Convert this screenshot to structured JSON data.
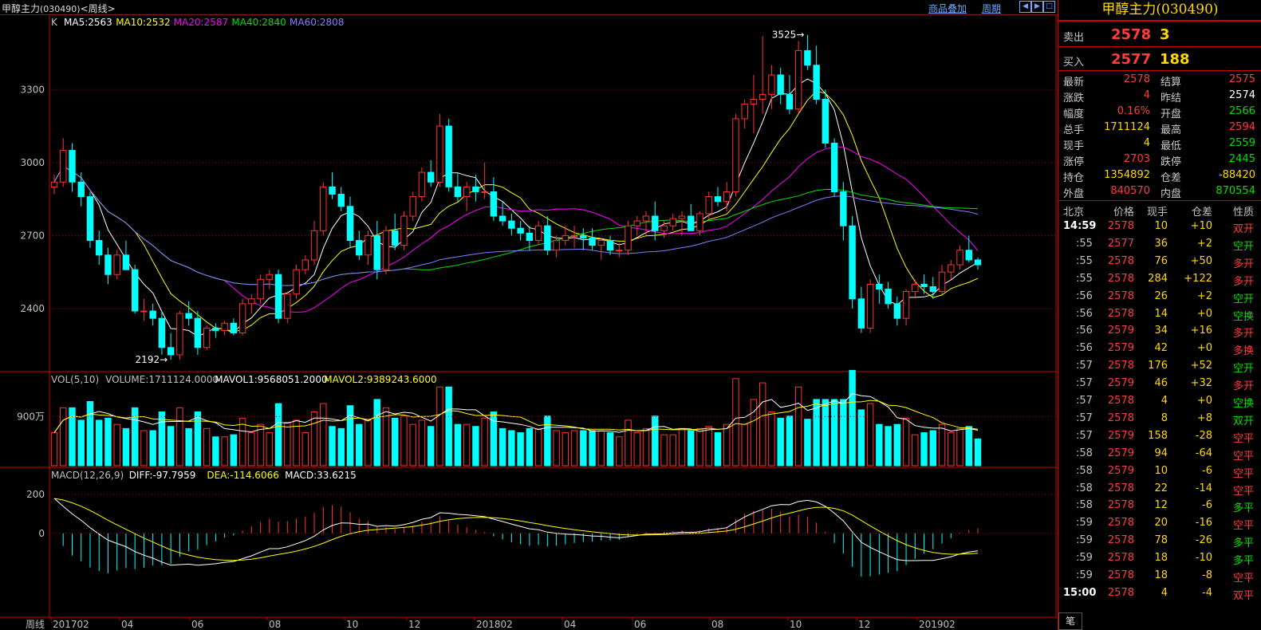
{
  "header": {
    "title": "甲醇主力",
    "code": "(030490)",
    "period": "<周线>",
    "overlay_link": "商品叠加",
    "period_link": "周期"
  },
  "kline": {
    "label": "K",
    "ma": [
      {
        "text": "MA5:2563",
        "color": "#ffffff"
      },
      {
        "text": "MA10:2532",
        "color": "#ffff00"
      },
      {
        "text": "MA20:2587",
        "color": "#ff00ff"
      },
      {
        "text": "MA40:2840",
        "color": "#00e000"
      },
      {
        "text": "MA60:2808",
        "color": "#8080ff"
      }
    ],
    "y_ticks": [
      "3300",
      "3000",
      "2700",
      "2400"
    ],
    "high_mark": "3525",
    "low_mark": "2192"
  },
  "volume": {
    "label": "VOL(5,10)",
    "volume": "VOLUME:1711124.0000",
    "mavol1": "MAVOL1:9568051.2000",
    "mavol2": "MAVOL2:9389243.6000",
    "y_tick": "900万"
  },
  "macd": {
    "label": "MACD(12,26,9)",
    "diff": "DIFF:-97.7959",
    "dea": "DEA:-114.6066",
    "macd": "MACD:33.6215",
    "y_ticks": [
      "200",
      "0"
    ]
  },
  "x_axis": {
    "corner": "周线",
    "labels": [
      "201702",
      "04",
      "06",
      "08",
      "10",
      "12",
      "201802",
      "04",
      "06",
      "08",
      "10",
      "12",
      "201902"
    ]
  },
  "side": {
    "title": "甲醇主力(030490)",
    "sell": {
      "label": "卖出",
      "price": "2578",
      "qty": "3"
    },
    "buy": {
      "label": "买入",
      "price": "2577",
      "qty": "188"
    },
    "quotes": [
      {
        "l1": "最新",
        "v1": "2578",
        "c1": "red",
        "l2": "结算",
        "v2": "2575",
        "c2": "red"
      },
      {
        "l1": "涨跌",
        "v1": "4",
        "c1": "red",
        "l2": "昨结",
        "v2": "2574",
        "c2": "wht"
      },
      {
        "l1": "幅度",
        "v1": "0.16%",
        "c1": "red",
        "l2": "开盘",
        "v2": "2566",
        "c2": "grn"
      },
      {
        "l1": "总手",
        "v1": "1711124",
        "c1": "yel",
        "l2": "最高",
        "v2": "2594",
        "c2": "red"
      },
      {
        "l1": "现手",
        "v1": "4",
        "c1": "yel",
        "l2": "最低",
        "v2": "2559",
        "c2": "grn"
      },
      {
        "l1": "涨停",
        "v1": "2703",
        "c1": "red",
        "l2": "跌停",
        "v2": "2445",
        "c2": "grn"
      },
      {
        "l1": "持仓",
        "v1": "1354892",
        "c1": "yel",
        "l2": "仓差",
        "v2": "-88420",
        "c2": "yel"
      },
      {
        "l1": "外盘",
        "v1": "840570",
        "c1": "red",
        "l2": "内盘",
        "v2": "870554",
        "c2": "grn"
      }
    ],
    "tick_header": [
      "北京",
      "价格",
      "现手",
      "仓差",
      "性质"
    ],
    "ticks": [
      {
        "t": "14:59",
        "p": "2578",
        "v": "10",
        "d": "+10",
        "n": "双开",
        "pc": "red",
        "dc": "yel",
        "nc": "red",
        "tw": true
      },
      {
        "t": ":55",
        "p": "2577",
        "v": "36",
        "d": "+2",
        "n": "空开",
        "pc": "red",
        "dc": "yel",
        "nc": "grn"
      },
      {
        "t": ":55",
        "p": "2578",
        "v": "76",
        "d": "+50",
        "n": "多开",
        "pc": "red",
        "dc": "yel",
        "nc": "red"
      },
      {
        "t": ":55",
        "p": "2578",
        "v": "284",
        "d": "+122",
        "n": "多开",
        "pc": "red",
        "dc": "yel",
        "nc": "red"
      },
      {
        "t": ":56",
        "p": "2578",
        "v": "26",
        "d": "+2",
        "n": "空开",
        "pc": "red",
        "dc": "yel",
        "nc": "grn"
      },
      {
        "t": ":56",
        "p": "2578",
        "v": "14",
        "d": "+0",
        "n": "空换",
        "pc": "red",
        "dc": "yel",
        "nc": "grn"
      },
      {
        "t": ":56",
        "p": "2579",
        "v": "34",
        "d": "+16",
        "n": "多开",
        "pc": "red",
        "dc": "yel",
        "nc": "red"
      },
      {
        "t": ":56",
        "p": "2579",
        "v": "42",
        "d": "+0",
        "n": "多换",
        "pc": "red",
        "dc": "yel",
        "nc": "red"
      },
      {
        "t": ":57",
        "p": "2578",
        "v": "176",
        "d": "+52",
        "n": "空开",
        "pc": "red",
        "dc": "yel",
        "nc": "grn"
      },
      {
        "t": ":57",
        "p": "2579",
        "v": "46",
        "d": "+32",
        "n": "多开",
        "pc": "red",
        "dc": "yel",
        "nc": "red"
      },
      {
        "t": ":57",
        "p": "2578",
        "v": "4",
        "d": "+0",
        "n": "空换",
        "pc": "red",
        "dc": "yel",
        "nc": "grn"
      },
      {
        "t": ":57",
        "p": "2578",
        "v": "8",
        "d": "+8",
        "n": "双开",
        "pc": "red",
        "dc": "yel",
        "nc": "grn"
      },
      {
        "t": ":57",
        "p": "2579",
        "v": "158",
        "d": "-28",
        "n": "空平",
        "pc": "red",
        "dc": "yel",
        "nc": "red"
      },
      {
        "t": ":58",
        "p": "2579",
        "v": "94",
        "d": "-64",
        "n": "空平",
        "pc": "red",
        "dc": "yel",
        "nc": "red"
      },
      {
        "t": ":58",
        "p": "2579",
        "v": "10",
        "d": "-6",
        "n": "空平",
        "pc": "red",
        "dc": "yel",
        "nc": "red"
      },
      {
        "t": ":58",
        "p": "2578",
        "v": "22",
        "d": "-14",
        "n": "空平",
        "pc": "red",
        "dc": "yel",
        "nc": "red"
      },
      {
        "t": ":58",
        "p": "2578",
        "v": "12",
        "d": "-6",
        "n": "多平",
        "pc": "red",
        "dc": "yel",
        "nc": "grn"
      },
      {
        "t": ":59",
        "p": "2578",
        "v": "20",
        "d": "-16",
        "n": "空平",
        "pc": "red",
        "dc": "yel",
        "nc": "red"
      },
      {
        "t": ":59",
        "p": "2578",
        "v": "78",
        "d": "-26",
        "n": "多平",
        "pc": "red",
        "dc": "yel",
        "nc": "grn"
      },
      {
        "t": ":59",
        "p": "2578",
        "v": "18",
        "d": "-10",
        "n": "多平",
        "pc": "red",
        "dc": "yel",
        "nc": "grn"
      },
      {
        "t": ":59",
        "p": "2578",
        "v": "18",
        "d": "-8",
        "n": "空平",
        "pc": "red",
        "dc": "yel",
        "nc": "red"
      },
      {
        "t": "15:00",
        "p": "2578",
        "v": "4",
        "d": "-4",
        "n": "双平",
        "pc": "red",
        "dc": "yel",
        "nc": "red",
        "tw": true
      }
    ],
    "tab": "笔"
  },
  "chart_data": {
    "type": "candlestick",
    "price_range": [
      2200,
      3550
    ],
    "candles": [
      [
        2900,
        2950,
        2870,
        2920
      ],
      [
        2920,
        3100,
        2900,
        3050
      ],
      [
        3050,
        3080,
        2880,
        2920
      ],
      [
        2920,
        2960,
        2820,
        2860
      ],
      [
        2860,
        2880,
        2650,
        2680
      ],
      [
        2680,
        2720,
        2580,
        2620
      ],
      [
        2620,
        2650,
        2500,
        2540
      ],
      [
        2540,
        2640,
        2520,
        2620
      ],
      [
        2620,
        2680,
        2580,
        2560
      ],
      [
        2560,
        2580,
        2380,
        2390
      ],
      [
        2390,
        2440,
        2350,
        2390
      ],
      [
        2390,
        2420,
        2330,
        2360
      ],
      [
        2360,
        2390,
        2210,
        2240
      ],
      [
        2240,
        2300,
        2190,
        2210
      ],
      [
        2210,
        2390,
        2190,
        2380
      ],
      [
        2380,
        2430,
        2330,
        2360
      ],
      [
        2360,
        2390,
        2210,
        2240
      ],
      [
        2240,
        2330,
        2230,
        2320
      ],
      [
        2320,
        2340,
        2280,
        2310
      ],
      [
        2310,
        2350,
        2290,
        2340
      ],
      [
        2340,
        2360,
        2290,
        2300
      ],
      [
        2300,
        2440,
        2290,
        2420
      ],
      [
        2420,
        2460,
        2380,
        2440
      ],
      [
        2440,
        2540,
        2420,
        2520
      ],
      [
        2520,
        2560,
        2480,
        2540
      ],
      [
        2540,
        2560,
        2340,
        2360
      ],
      [
        2360,
        2470,
        2340,
        2460
      ],
      [
        2460,
        2580,
        2440,
        2560
      ],
      [
        2560,
        2620,
        2540,
        2600
      ],
      [
        2600,
        2760,
        2580,
        2720
      ],
      [
        2720,
        2920,
        2700,
        2900
      ],
      [
        2900,
        2960,
        2850,
        2870
      ],
      [
        2870,
        2900,
        2800,
        2820
      ],
      [
        2820,
        2860,
        2650,
        2680
      ],
      [
        2680,
        2720,
        2600,
        2620
      ],
      [
        2620,
        2720,
        2580,
        2700
      ],
      [
        2700,
        2760,
        2520,
        2560
      ],
      [
        2560,
        2740,
        2540,
        2720
      ],
      [
        2720,
        2790,
        2640,
        2660
      ],
      [
        2660,
        2800,
        2640,
        2780
      ],
      [
        2780,
        2880,
        2760,
        2860
      ],
      [
        2860,
        2980,
        2840,
        2960
      ],
      [
        2960,
        3010,
        2900,
        2920
      ],
      [
        2920,
        3200,
        2900,
        3150
      ],
      [
        3150,
        3180,
        2880,
        2900
      ],
      [
        2900,
        2960,
        2840,
        2860
      ],
      [
        2860,
        2920,
        2800,
        2900
      ],
      [
        2900,
        2950,
        2840,
        2880
      ],
      [
        2880,
        3000,
        2850,
        2880
      ],
      [
        2880,
        2940,
        2760,
        2780
      ],
      [
        2780,
        2840,
        2740,
        2760
      ],
      [
        2760,
        2790,
        2700,
        2730
      ],
      [
        2730,
        2760,
        2680,
        2710
      ],
      [
        2710,
        2740,
        2640,
        2680
      ],
      [
        2680,
        2760,
        2660,
        2740
      ],
      [
        2740,
        2780,
        2620,
        2640
      ],
      [
        2640,
        2700,
        2610,
        2680
      ],
      [
        2680,
        2740,
        2660,
        2700
      ],
      [
        2700,
        2740,
        2650,
        2700
      ],
      [
        2700,
        2730,
        2640,
        2690
      ],
      [
        2690,
        2730,
        2640,
        2660
      ],
      [
        2660,
        2690,
        2600,
        2680
      ],
      [
        2680,
        2700,
        2620,
        2640
      ],
      [
        2640,
        2670,
        2610,
        2640
      ],
      [
        2640,
        2760,
        2620,
        2740
      ],
      [
        2740,
        2780,
        2700,
        2760
      ],
      [
        2760,
        2800,
        2700,
        2780
      ],
      [
        2780,
        2840,
        2680,
        2720
      ],
      [
        2720,
        2760,
        2690,
        2740
      ],
      [
        2740,
        2790,
        2720,
        2770
      ],
      [
        2770,
        2800,
        2700,
        2780
      ],
      [
        2780,
        2830,
        2740,
        2720
      ],
      [
        2720,
        2800,
        2700,
        2790
      ],
      [
        2790,
        2880,
        2770,
        2860
      ],
      [
        2860,
        2900,
        2820,
        2840
      ],
      [
        2840,
        2920,
        2800,
        2880
      ],
      [
        2880,
        3200,
        2860,
        3180
      ],
      [
        3180,
        3260,
        3140,
        3240
      ],
      [
        3240,
        3360,
        3120,
        3260
      ],
      [
        3260,
        3520,
        3200,
        3280
      ],
      [
        3280,
        3400,
        3220,
        3360
      ],
      [
        3360,
        3390,
        3240,
        3280
      ],
      [
        3280,
        3360,
        3200,
        3220
      ],
      [
        3220,
        3500,
        3200,
        3460
      ],
      [
        3460,
        3525,
        3380,
        3400
      ],
      [
        3400,
        3480,
        3240,
        3260
      ],
      [
        3260,
        3300,
        3060,
        3080
      ],
      [
        3080,
        3100,
        2860,
        2880
      ],
      [
        2880,
        2920,
        2680,
        2740
      ],
      [
        2740,
        2780,
        2400,
        2440
      ],
      [
        2440,
        2490,
        2300,
        2320
      ],
      [
        2320,
        2520,
        2300,
        2500
      ],
      [
        2500,
        2540,
        2420,
        2480
      ],
      [
        2480,
        2510,
        2400,
        2420
      ],
      [
        2420,
        2450,
        2330,
        2360
      ],
      [
        2360,
        2480,
        2330,
        2470
      ],
      [
        2470,
        2520,
        2450,
        2500
      ],
      [
        2500,
        2540,
        2460,
        2490
      ],
      [
        2490,
        2530,
        2440,
        2470
      ],
      [
        2470,
        2580,
        2460,
        2550
      ],
      [
        2550,
        2600,
        2520,
        2580
      ],
      [
        2580,
        2660,
        2560,
        2640
      ],
      [
        2640,
        2700,
        2590,
        2600
      ],
      [
        2600,
        2610,
        2560,
        2580
      ]
    ],
    "volume_max": 14000000,
    "macd_range": [
      -400,
      250
    ]
  }
}
